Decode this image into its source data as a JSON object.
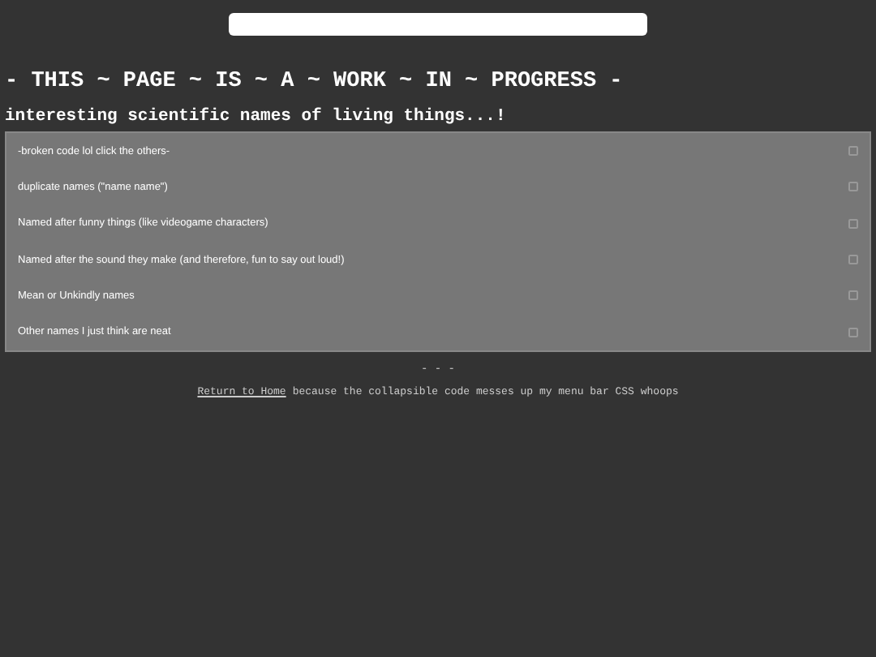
{
  "heading": "- THIS ~ PAGE ~ IS ~ A ~ WORK ~ IN ~ PROGRESS -",
  "subtitle": "interesting scientific names of living things...!",
  "sections": [
    {
      "label": "-broken code lol click the others-",
      "expanded": false
    },
    {
      "label": "duplicate names (\"name name\")",
      "expanded": false
    },
    {
      "label": "Named after funny things (like videogame characters)",
      "expanded": false
    },
    {
      "label": "Named after the sound they make (and therefore, fun to say out loud!)",
      "expanded": false
    },
    {
      "label": "Mean or Unkindly names",
      "expanded": false
    },
    {
      "label": "Other names I just think are neat",
      "expanded": false
    }
  ],
  "divider": "- - -",
  "footer": {
    "link": "Return to Home",
    "text": "because the collapsible code messes up my menu bar CSS whoops"
  }
}
